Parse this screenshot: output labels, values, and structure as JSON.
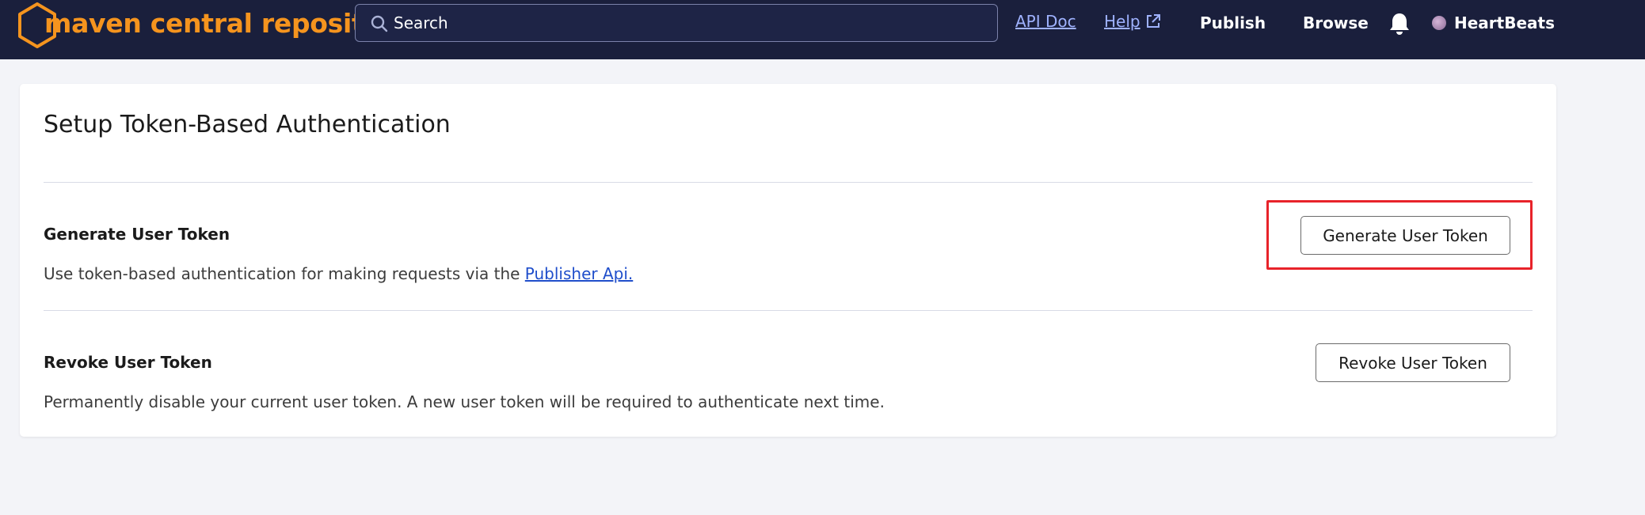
{
  "header": {
    "logo_text": "maven central repository",
    "search": {
      "placeholder": "Search",
      "value": ""
    },
    "links": {
      "api_doc": "API Doc",
      "help": "Help",
      "publish": "Publish",
      "browse": "Browse"
    },
    "user": {
      "name": "HeartBeats"
    },
    "colors": {
      "nav_background": "#1a1f3c",
      "brand_orange": "#f5941e",
      "link": "#9fb2ff"
    }
  },
  "main": {
    "title": "Setup Token-Based Authentication",
    "generate": {
      "title": "Generate User Token",
      "description_prefix": "Use token-based authentication for making requests via the ",
      "link_text": "Publisher Api.",
      "button_label": "Generate User Token"
    },
    "revoke": {
      "title": "Revoke User Token",
      "description": "Permanently disable your current user token. A new user token will be required to authenticate next time.",
      "button_label": "Revoke User Token"
    },
    "colors": {
      "highlight": "#e8232a",
      "inline_link": "#1f4ecb"
    }
  }
}
